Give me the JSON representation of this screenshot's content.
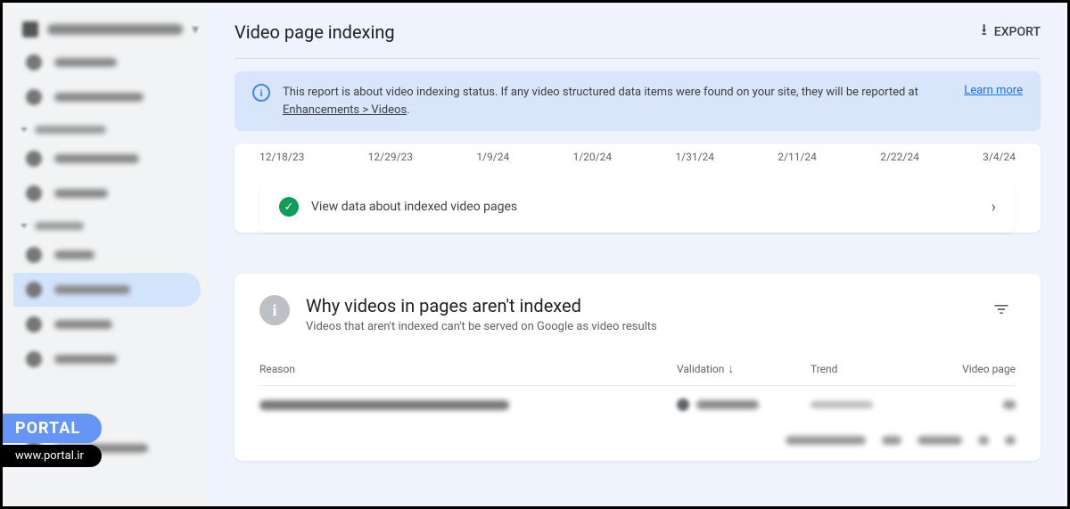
{
  "page_title": "Video page indexing",
  "export_label": "EXPORT",
  "banner": {
    "text_before_link": "This report is about video indexing status. If any video structured data items were found on your site, they will be reported at ",
    "link_text": "Enhancements > Videos",
    "text_after_link": ".",
    "learn_more": "Learn more"
  },
  "chart_dates": [
    "12/18/23",
    "12/29/23",
    "1/9/24",
    "1/20/24",
    "1/31/24",
    "2/11/24",
    "2/22/24",
    "3/4/24"
  ],
  "view_data_text": "View data about indexed video pages",
  "why_section": {
    "title": "Why videos in pages aren't indexed",
    "subtitle": "Videos that aren't indexed can't be served on Google as video results"
  },
  "table": {
    "headers": {
      "reason": "Reason",
      "validation": "Validation",
      "trend": "Trend",
      "pages": "Video page"
    }
  },
  "portal_badge": {
    "label": "PORTAL",
    "url": "www.portal.ir"
  }
}
